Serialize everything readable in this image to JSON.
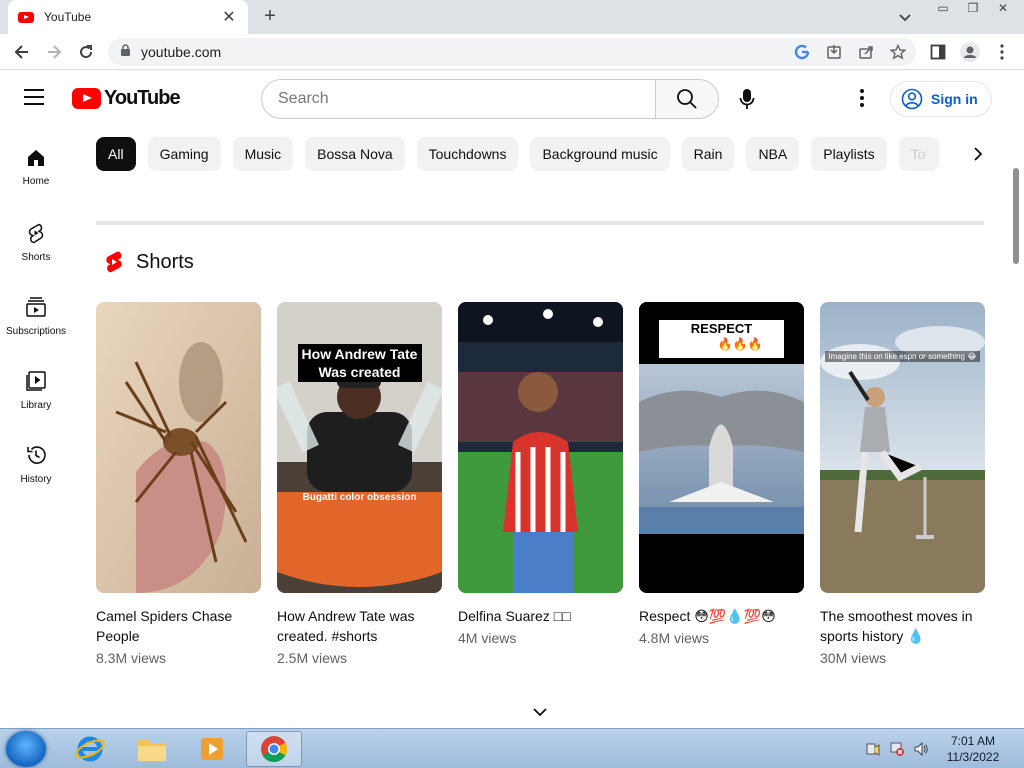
{
  "browser": {
    "tab_title": "YouTube",
    "url": "youtube.com"
  },
  "header": {
    "logo_text": "YouTube",
    "search_placeholder": "Search",
    "signin_label": "Sign in"
  },
  "guide": {
    "items": [
      {
        "label": "Home",
        "icon": "home-icon"
      },
      {
        "label": "Shorts",
        "icon": "shorts-icon"
      },
      {
        "label": "Subscriptions",
        "icon": "subscriptions-icon"
      },
      {
        "label": "Library",
        "icon": "library-icon"
      },
      {
        "label": "History",
        "icon": "history-icon"
      }
    ]
  },
  "chips": [
    "All",
    "Gaming",
    "Music",
    "Bossa Nova",
    "Touchdowns",
    "Background music",
    "Rain",
    "NBA",
    "Playlists",
    "To"
  ],
  "shorts": {
    "heading": "Shorts",
    "items": [
      {
        "title": "Camel Spiders Chase People",
        "views": "8.3M views"
      },
      {
        "title": "How Andrew Tate was created. #shorts",
        "views": "2.5M views",
        "overlay_top": "How Andrew Tate Was created",
        "overlay_bottom": "Bugatti color obsession"
      },
      {
        "title": "Delfina Suarez □□",
        "views": "4M views"
      },
      {
        "title": "Respect 😳💯💧💯😳",
        "views": "4.8M views",
        "overlay_top": "RESPECT",
        "overlay_emoji": "😱😱😱🔥🔥🔥"
      },
      {
        "title": "The smoothest moves in sports history 💧",
        "views": "30M views",
        "overlay_top": "Imagine this on like espn or something 😂"
      }
    ]
  },
  "taskbar": {
    "time": "7:01 AM",
    "date": "11/3/2022"
  },
  "colors": {
    "brand_red": "#ff0000",
    "link_blue": "#065fd4",
    "chip_bg": "#f2f2f2"
  }
}
